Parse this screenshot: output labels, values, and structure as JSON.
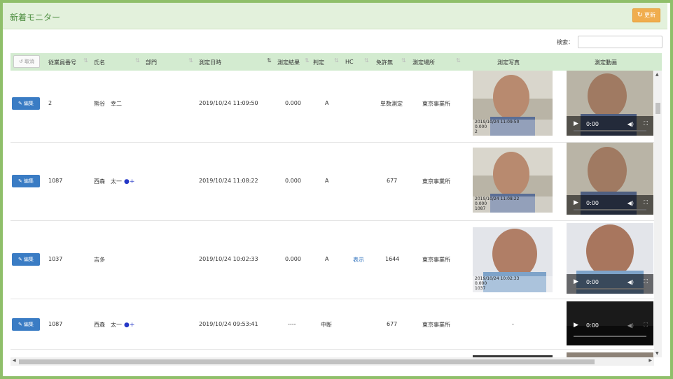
{
  "header": {
    "title": "新着モニター",
    "refresh_label": "更新"
  },
  "search": {
    "label": "検索：",
    "value": ""
  },
  "table": {
    "cancel_label": "取消",
    "columns": [
      "従業員番号",
      "氏名",
      "部門",
      "測定日時",
      "測定結果",
      "判定",
      "HC",
      "免許無",
      "測定場所",
      "測定写真",
      "測定動画"
    ],
    "edit_label": "編集",
    "rows": [
      {
        "emp_no": "2",
        "name": "熊谷　幸二",
        "dept": "",
        "datetime": "2019/10/24 11:09:50",
        "result": "0.000",
        "judge": "A",
        "hc": "",
        "license": "単数測定",
        "place": "東京事業所",
        "photo_caption": [
          "2019/10/24 11:09:50",
          "0.000",
          "2"
        ],
        "video_time": "0:00"
      },
      {
        "emp_no": "1087",
        "name": "西森　太一",
        "dept": "",
        "datetime": "2019/10/24 11:08:22",
        "result": "0.000",
        "judge": "A",
        "hc": "",
        "license": "677",
        "place": "東京事業所",
        "photo_caption": [
          "2019/10/24 11:08:22",
          "0.000",
          "1087"
        ],
        "video_time": "0:00"
      },
      {
        "emp_no": "1037",
        "name": "吉多",
        "dept": "",
        "datetime": "2019/10/24 10:02:33",
        "result": "0.000",
        "judge": "A",
        "hc": "表示",
        "license": "1644",
        "place": "東京事業所",
        "photo_caption": [
          "2019/10/24 10:02:33",
          "0.000",
          "1037"
        ],
        "video_time": "0:00"
      },
      {
        "emp_no": "1087",
        "name": "西森　太一",
        "dept": "",
        "datetime": "2019/10/24 09:53:41",
        "result": "----",
        "judge": "中断",
        "hc": "",
        "license": "677",
        "place": "東京事業所",
        "photo_placeholder": "-",
        "video_time": "0:00"
      }
    ]
  },
  "colors": {
    "header_bg": "#e3f1dc",
    "title": "#4c8d3f",
    "frame": "#8fbf6a",
    "table_header": "#d3ebd0",
    "edit_button": "#3a7cc4",
    "refresh_button": "#f0ad4e"
  }
}
